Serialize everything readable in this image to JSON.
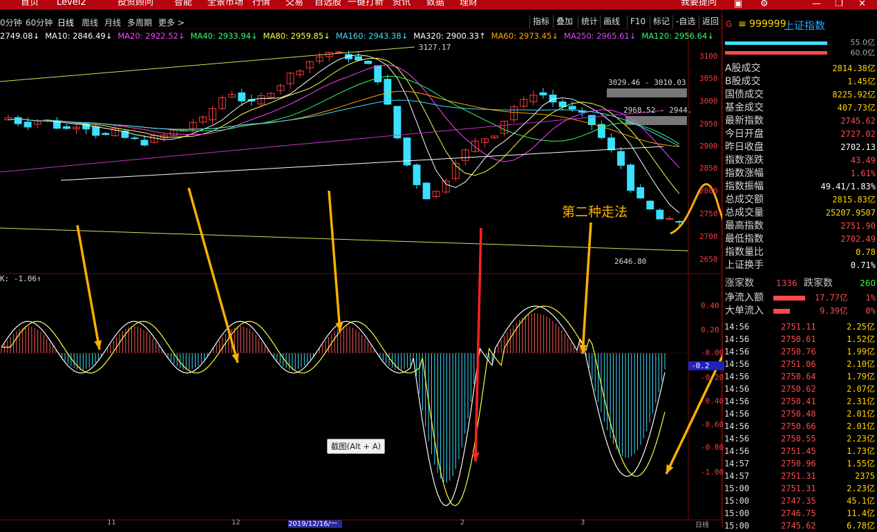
{
  "topbar": {
    "menu": [
      "首页",
      "Level2",
      "投资顾问",
      "智能",
      "全景市场",
      "行情",
      "交易",
      "自选股",
      "一键打新",
      "资讯",
      "数据",
      "理财"
    ],
    "help": "我要提问"
  },
  "periods": [
    "0分钟",
    "60分钟",
    "日线",
    "周线",
    "月线",
    "多周期",
    "更多 >"
  ],
  "active_period": "日线",
  "tools": [
    "指标",
    "叠加",
    "统计",
    "画线",
    "F10",
    "标记",
    "-自选",
    "返回"
  ],
  "ma_line": [
    {
      "text": "2749.08↓",
      "color": "#ffffff"
    },
    {
      "text": "MA10: 2846.49↓",
      "color": "#ffffff"
    },
    {
      "text": "MA20: 2922.52↓",
      "color": "#ff44ff"
    },
    {
      "text": "MA40: 2933.94↓",
      "color": "#33ff66"
    },
    {
      "text": "MA80: 2959.85↓",
      "color": "#ffff44"
    },
    {
      "text": "MA160: 2943.38↓",
      "color": "#44ddff"
    },
    {
      "text": "MA320: 2900.33↑",
      "color": "#ffffff"
    },
    {
      "text": "MA60: 2973.45↓",
      "color": "#ffaa00"
    },
    {
      "text": "MA250: 2965.61↓",
      "color": "#dd44ff"
    },
    {
      "text": "MA120: 2956.64↓",
      "color": "#33ff66"
    }
  ],
  "price_axis": [
    "3100",
    "3050",
    "3000",
    "2950",
    "2900",
    "2850",
    "2800",
    "2750",
    "2700",
    "2650"
  ],
  "osc_axis": [
    "0.40",
    "0.20",
    "-0.00",
    "-0.20",
    "-0.40",
    "-0.60",
    "-0.80",
    "-1.00"
  ],
  "osc_marker": "-0.2",
  "osc_label": "K: -1.06↑",
  "price_labels": {
    "high": "3127.17",
    "low": "2646.80",
    "zone1": "3029.46 - 3010.03",
    "zone2": "2968.52 - 2944."
  },
  "annotation": "第二种走法",
  "tooltip": "截图(Alt + A)",
  "dates": {
    "selected": "2019/12/16/一",
    "ticks": [
      "11",
      "12",
      "2",
      "3"
    ],
    "right": "日线"
  },
  "panel": {
    "g": "G",
    "code": "≡ 999999",
    "name": "上证指数",
    "bar1": "55.0亿",
    "bar2": "60.0亿",
    "stats": [
      {
        "k": "A股成交",
        "v": "2814.38亿",
        "c": "#ffd700"
      },
      {
        "k": "B股成交",
        "v": "1.45亿",
        "c": "#ffd700"
      },
      {
        "k": "国债成交",
        "v": "8225.92亿",
        "c": "#ffd700"
      },
      {
        "k": "基金成交",
        "v": "407.73亿",
        "c": "#ffd700"
      },
      {
        "k": "最新指数",
        "v": "2745.62",
        "c": "#ff4a4a"
      },
      {
        "k": "今日开盘",
        "v": "2727.02",
        "c": "#ff4a4a"
      },
      {
        "k": "昨日收盘",
        "v": "2702.13",
        "c": "#ffffff"
      },
      {
        "k": "指数涨跌",
        "v": "43.49",
        "c": "#ff4a4a"
      },
      {
        "k": "指数涨幅",
        "v": "1.61%",
        "c": "#ff4a4a"
      },
      {
        "k": "指数振幅",
        "v": "49.41/1.83%",
        "c": "#ffffff"
      },
      {
        "k": "总成交额",
        "v": "2815.83亿",
        "c": "#ffd700"
      },
      {
        "k": "总成交量",
        "v": "25207.9507",
        "c": "#ffd700"
      },
      {
        "k": "最高指数",
        "v": "2751.90",
        "c": "#ff4a4a"
      },
      {
        "k": "最低指数",
        "v": "2702.49",
        "c": "#ff4a4a"
      },
      {
        "k": "指数量比",
        "v": "0.78",
        "c": "#ffd700"
      },
      {
        "k": "上证换手",
        "v": "0.71%",
        "c": "#ffffff"
      }
    ],
    "up_label": "涨家数",
    "up": "1336",
    "down_label": "跌家数",
    "down": "260",
    "flow": [
      {
        "k": "净流入额",
        "v": "17.77亿",
        "p": "1%"
      },
      {
        "k": "大单流入",
        "v": "9.39亿",
        "p": "0%"
      }
    ],
    "ticks": [
      {
        "t": "14:56",
        "p": "2751.11",
        "v": "2.25亿"
      },
      {
        "t": "14:56",
        "p": "2750.61",
        "v": "1.52亿"
      },
      {
        "t": "14:56",
        "p": "2750.76",
        "v": "1.99亿"
      },
      {
        "t": "14:56",
        "p": "2751.06",
        "v": "2.10亿"
      },
      {
        "t": "14:56",
        "p": "2750.64",
        "v": "1.79亿"
      },
      {
        "t": "14:56",
        "p": "2750.62",
        "v": "2.07亿"
      },
      {
        "t": "14:56",
        "p": "2750.41",
        "v": "2.31亿"
      },
      {
        "t": "14:56",
        "p": "2750.48",
        "v": "2.01亿"
      },
      {
        "t": "14:56",
        "p": "2750.66",
        "v": "2.01亿"
      },
      {
        "t": "14:56",
        "p": "2750.55",
        "v": "2.23亿"
      },
      {
        "t": "14:56",
        "p": "2751.45",
        "v": "1.73亿"
      },
      {
        "t": "14:57",
        "p": "2750.96",
        "v": "1.55亿"
      },
      {
        "t": "14:57",
        "p": "2751.31",
        "v": "2375"
      },
      {
        "t": "15:00",
        "p": "2751.31",
        "v": "2.23亿"
      },
      {
        "t": "15:00",
        "p": "2747.35",
        "v": "45.1亿"
      },
      {
        "t": "15:00",
        "p": "2746.75",
        "v": "11.4亿"
      },
      {
        "t": "15:00",
        "p": "2745.62",
        "v": "6.78亿"
      }
    ]
  }
}
